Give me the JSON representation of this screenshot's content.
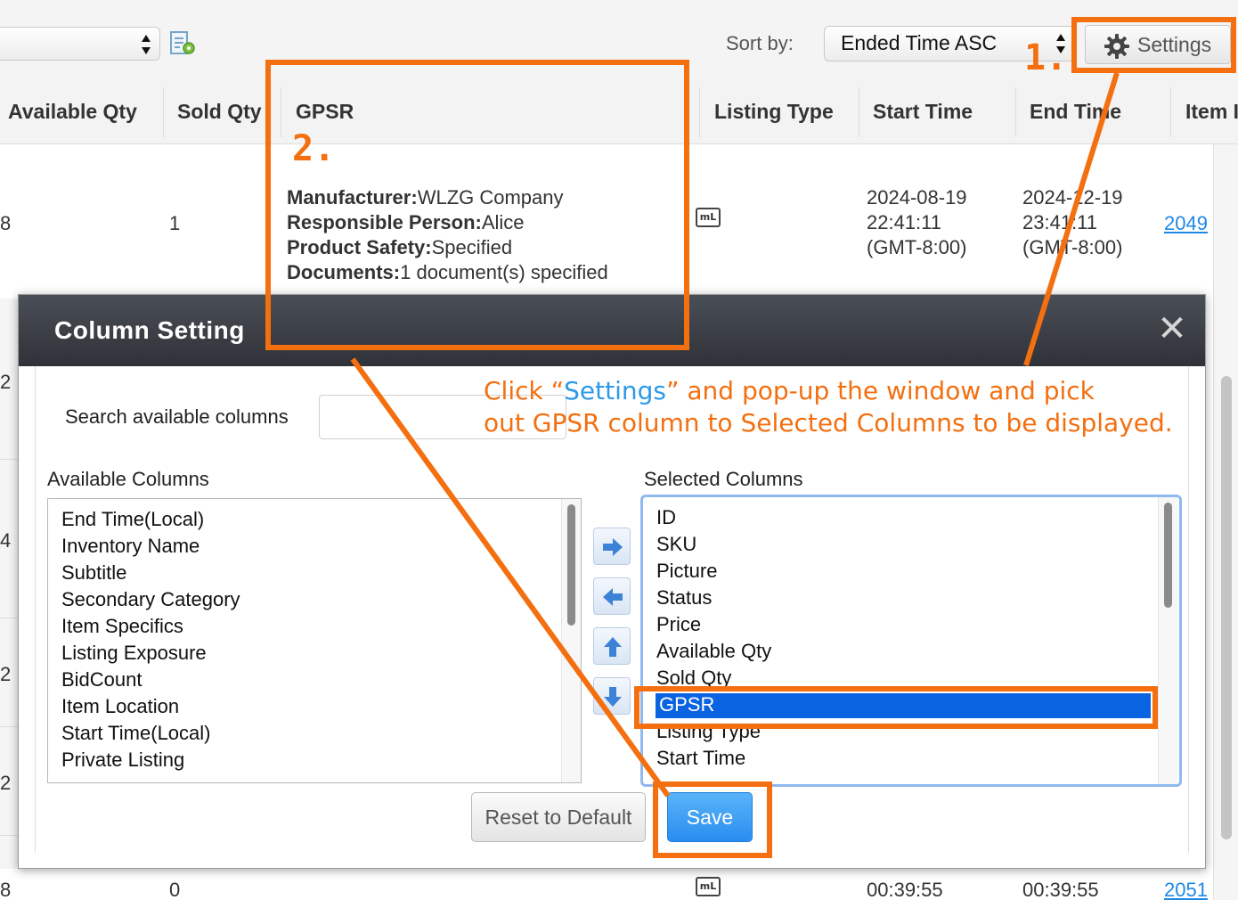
{
  "toolbar": {
    "sort_label": "Sort by:",
    "sort_value": "Ended Time ASC",
    "settings_label": "Settings"
  },
  "table": {
    "headers": [
      "Available Qty",
      "Sold Qty",
      "GPSR",
      "Listing Type",
      "Start Time",
      "End Time",
      "Item I"
    ],
    "row1": {
      "available_qty": "8",
      "sold_qty": "1",
      "gpsr": {
        "manufacturer_label": "Manufacturer:",
        "manufacturer_value": "WLZG Company",
        "responsible_label": "Responsible Person:",
        "responsible_value": "Alice",
        "safety_label": "Product Safety:",
        "safety_value": "Specified",
        "documents_label": "Documents:",
        "documents_value": "1  document(s) specified"
      },
      "listing_type_icon": "mL",
      "start_date": "2024-08-19",
      "start_clock": "22:41:11",
      "start_tz": "(GMT-8:00)",
      "end_date": "2024-12-19",
      "end_clock": "23:41:11",
      "end_tz": "(GMT-8:00)",
      "item_id": "2049"
    },
    "partial_rows": [
      "2",
      "4",
      "2",
      "2"
    ],
    "last_row": {
      "available_qty": "8",
      "sold_qty": "0",
      "listing_type_icon": "mL",
      "start_clock": "00:39:55",
      "end_clock": "00:39:55",
      "item_id": "2051"
    }
  },
  "modal": {
    "title": "Column Setting",
    "close_glyph": "✕",
    "search_label": "Search available columns",
    "search_value": "",
    "available_label": "Available Columns",
    "selected_label": "Selected Columns",
    "available_columns": [
      "End Time(Local)",
      "Inventory Name",
      "Subtitle",
      "Secondary Category",
      "Item Specifics",
      "Listing Exposure",
      "BidCount",
      "Item Location",
      "Start Time(Local)",
      "Private Listing"
    ],
    "selected_columns": [
      "ID",
      "SKU",
      "Picture",
      "Status",
      "Price",
      "Available Qty",
      "Sold Qty",
      "GPSR",
      "Listing Type",
      "Start Time"
    ],
    "selected_highlight": "GPSR",
    "reset_label": "Reset to Default",
    "save_label": "Save"
  },
  "annotations": {
    "step1": "1.",
    "step2": "2.",
    "instruction_line1_pre": "Click “",
    "instruction_line1_key": "Settings",
    "instruction_line1_post": "” and pop-up the window and pick",
    "instruction_line2": "out GPSR column to Selected Columns to be displayed."
  },
  "colors": {
    "annotation": "#f36f10",
    "highlight": "#0a63e0",
    "save_button": "#2a8ef0",
    "modal_header": "#3a3d44",
    "link": "#1e88e5"
  },
  "icons": [
    "export-icon",
    "gear-icon",
    "close-icon",
    "arrow-right-icon",
    "arrow-left-icon",
    "arrow-up-icon",
    "arrow-down-icon",
    "listing-type-icon"
  ]
}
